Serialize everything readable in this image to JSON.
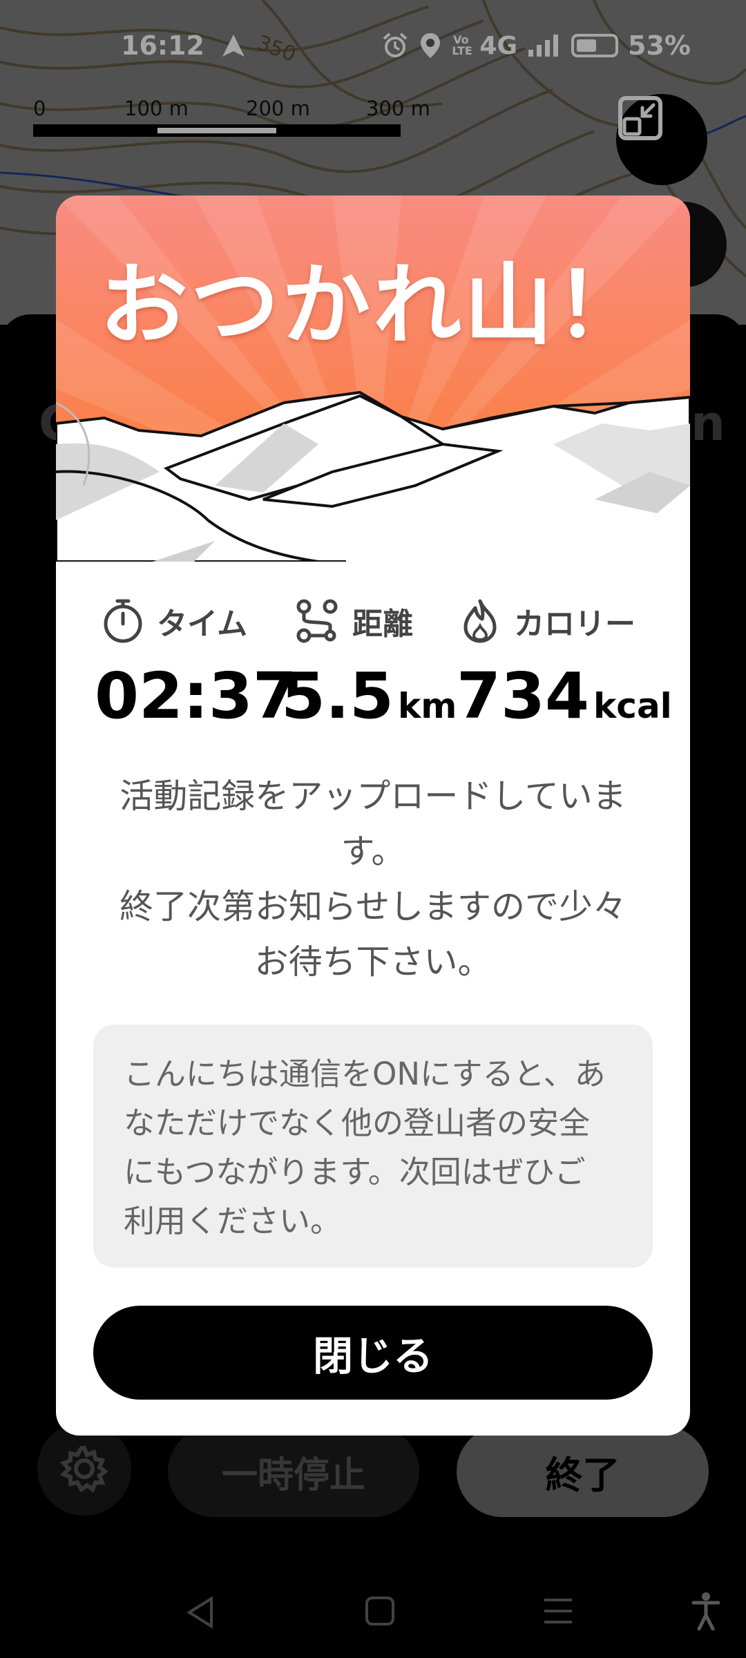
{
  "status_bar": {
    "time": "16:12",
    "network": "4G",
    "volte": "Vo LTE",
    "battery": "53%",
    "icons": [
      "navigation-icon",
      "alarm-icon",
      "location-icon",
      "signal-icon",
      "battery-icon"
    ]
  },
  "map": {
    "scale_labels": [
      "0",
      "100 m",
      "200 m",
      "300 m"
    ],
    "contour_label": "350"
  },
  "modal": {
    "title": "おつかれ山！",
    "stats": {
      "time": {
        "label": "タイム",
        "value": "02:37",
        "icon": "stopwatch-icon"
      },
      "distance": {
        "label": "距離",
        "value": "5.5",
        "unit": "km",
        "icon": "route-icon"
      },
      "calories": {
        "label": "カロリー",
        "value": "734",
        "unit": "kcal",
        "icon": "flame-icon"
      }
    },
    "message_lines": [
      "活動記録をアップロードしていま",
      "す。",
      "終了次第お知らせしますので少々",
      "お待ち下さい。"
    ],
    "note_lines": [
      "こんにちは通信をONにすると、あ",
      "なただけでなく他の登山者の安全",
      "にもつながります。次回はぜひご",
      "利用ください。"
    ],
    "close_label": "閉じる"
  },
  "background_controls": {
    "pause_label": "一時停止",
    "end_label": "終了"
  },
  "colors": {
    "hero_top": "#F98C82",
    "hero_bottom": "#FB7A2C",
    "primary_button": "#000000",
    "note_background": "#EFEFEF"
  }
}
